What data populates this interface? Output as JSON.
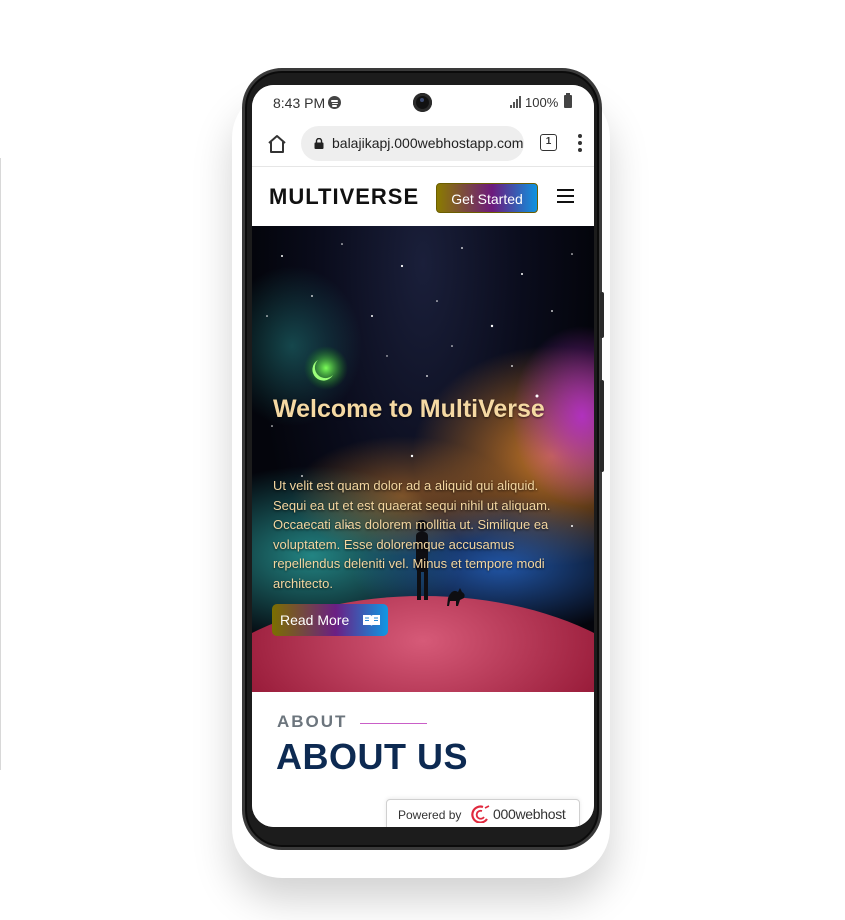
{
  "status_bar": {
    "time": "8:43 PM",
    "battery": "100%"
  },
  "browser": {
    "url": "balajikapj.000webhostapp.com",
    "tab_count": "1"
  },
  "site": {
    "logo": "MULTIVERSE",
    "cta_label": "Get Started"
  },
  "hero": {
    "title": "Welcome to MultiVerse",
    "body": "Ut velit est quam dolor ad a aliquid qui aliquid. Sequi ea ut et est quaerat sequi nihil ut aliquam. Occaecati alias dolorem mollitia ut. Similique ea voluptatem. Esse doloremque accusamus repellendus deleniti vel. Minus et tempore modi architecto.",
    "button_label": "Read More"
  },
  "about": {
    "eyebrow": "ABOUT",
    "title": "ABOUT US"
  },
  "badge": {
    "powered_by": "Powered by",
    "brand": "000webhost"
  },
  "colors": {
    "accent_gradient_start": "#8a7b00",
    "accent_gradient_mid": "#6d1a7d",
    "accent_gradient_end": "#0e93e0",
    "hero_text": "#f3d6a0",
    "about_title": "#0d2a52",
    "about_line": "#c95ec7"
  },
  "icons": [
    "spotify-icon",
    "signal-icon",
    "battery-icon",
    "home-icon",
    "lock-icon",
    "tabs-icon",
    "menu-dots-icon",
    "hamburger-icon",
    "book-icon",
    "host-logo-icon"
  ]
}
